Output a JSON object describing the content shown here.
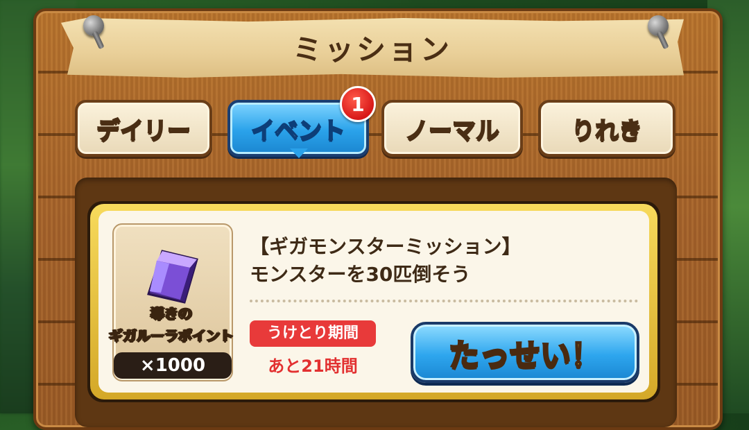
{
  "header": {
    "title": "ミッション"
  },
  "tabs": [
    {
      "label": "デイリー",
      "active": false
    },
    {
      "label": "イベント",
      "active": true,
      "badge": "1"
    },
    {
      "label": "ノーマル",
      "active": false
    },
    {
      "label": "りれき",
      "active": false
    }
  ],
  "mission": {
    "title": "【ギガモンスターミッション】",
    "description": "モンスターを30匹倒そう",
    "reward": {
      "name_line1": "導きの",
      "name_line2": "ギガルーラポイント",
      "quantity": "×1000",
      "icon": "purple-crystal-icon"
    },
    "period_label": "うけとり期間",
    "period_value": "あと21時間",
    "achieve_button": "たっせい！"
  },
  "colors": {
    "active_tab": "#2aa2ea",
    "badge": "#d81818",
    "period_label_bg": "#e83a3a",
    "achieve_text": "#ffe23a",
    "card_border": "#f7da5c"
  }
}
